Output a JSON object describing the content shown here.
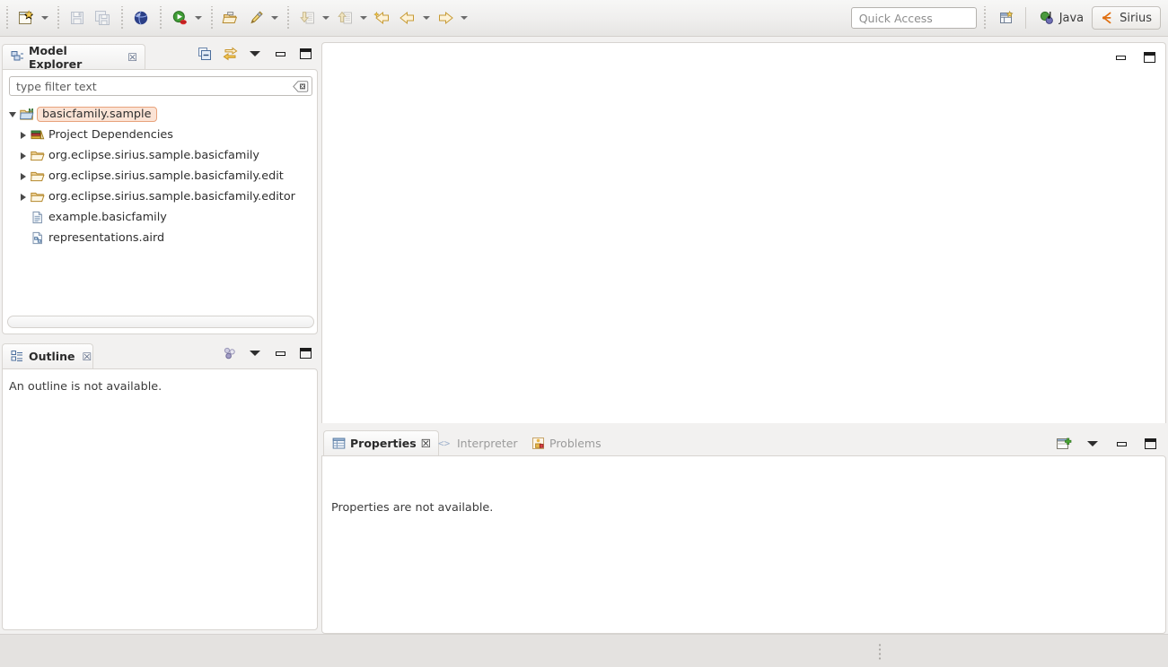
{
  "window": {
    "title": "Eclipse Sirius Workbench",
    "perspective": "Sirius"
  },
  "toolbar": {
    "items": [
      {
        "name": "new-wizard",
        "icon": "new-file-icon",
        "label": "New",
        "has_dropdown": true,
        "enabled": true
      },
      {
        "name": "save",
        "icon": "save-icon",
        "label": "Save",
        "has_dropdown": false,
        "enabled": false
      },
      {
        "name": "save-all",
        "icon": "save-all-icon",
        "label": "Save All",
        "has_dropdown": false,
        "enabled": false
      },
      {
        "name": "open-browser",
        "icon": "globe-icon",
        "label": "Open Web Browser",
        "has_dropdown": false,
        "enabled": true
      },
      {
        "name": "run",
        "icon": "run-icon",
        "label": "Run",
        "has_dropdown": true,
        "enabled": true
      },
      {
        "name": "new-folder",
        "icon": "open-folder-icon",
        "label": "New Folder",
        "has_dropdown": false,
        "enabled": true
      },
      {
        "name": "new-representation",
        "icon": "pencil-icon",
        "label": "New Representation",
        "has_dropdown": true,
        "enabled": true
      },
      {
        "name": "import",
        "icon": "import-icon",
        "label": "Import",
        "has_dropdown": true,
        "enabled": false
      },
      {
        "name": "export",
        "icon": "export-icon",
        "label": "Export",
        "has_dropdown": true,
        "enabled": false
      },
      {
        "name": "back-to-start",
        "icon": "back-star-arrow-icon",
        "label": "Back",
        "has_dropdown": false,
        "enabled": true
      },
      {
        "name": "previous-edit",
        "icon": "left-arrow-icon",
        "label": "Previous Annotation",
        "has_dropdown": true,
        "enabled": true
      },
      {
        "name": "next-edit",
        "icon": "right-arrow-icon",
        "label": "Next Annotation",
        "has_dropdown": true,
        "enabled": true
      }
    ],
    "quick_access": {
      "placeholder": "Quick Access",
      "value": ""
    },
    "open_perspective": {
      "icon": "open-perspective-icon",
      "label": "Open Perspective"
    },
    "perspectives": [
      {
        "name": "java",
        "label": "Java",
        "icon": "java-perspective-icon",
        "active": false
      },
      {
        "name": "sirius",
        "label": "Sirius",
        "icon": "sirius-perspective-icon",
        "active": true
      }
    ]
  },
  "model_explorer": {
    "tab_label": "Model Explorer",
    "tab_icon": "model-explorer-icon",
    "close_glyph": "☒",
    "tools": [
      {
        "name": "collapse-all",
        "icon": "collapse-all-icon",
        "tooltip": "Collapse All"
      },
      {
        "name": "link-with-editor",
        "icon": "link-with-editor-icon",
        "tooltip": "Link with Editor"
      },
      {
        "name": "view-menu",
        "icon": "view-menu-icon",
        "tooltip": "View Menu"
      },
      {
        "name": "minimize",
        "icon": "minimize-icon",
        "tooltip": "Minimize"
      },
      {
        "name": "maximize",
        "icon": "maximize-icon",
        "tooltip": "Maximize"
      }
    ],
    "filter": {
      "placeholder": "type filter text",
      "value": "",
      "clear_icon": "clear-field-icon"
    },
    "tree": [
      {
        "label": "basicfamily.sample",
        "icon": "modeling-project-icon",
        "twisty": "open",
        "indent": 0,
        "selected": true
      },
      {
        "label": "Project Dependencies",
        "icon": "libraries-icon",
        "twisty": "closed",
        "indent": 1,
        "selected": false
      },
      {
        "label": "org.eclipse.sirius.sample.basicfamily",
        "icon": "folder-icon",
        "twisty": "closed",
        "indent": 1,
        "selected": false
      },
      {
        "label": "org.eclipse.sirius.sample.basicfamily.edit",
        "icon": "folder-icon",
        "twisty": "closed",
        "indent": 1,
        "selected": false
      },
      {
        "label": "org.eclipse.sirius.sample.basicfamily.editor",
        "icon": "folder-icon",
        "twisty": "closed",
        "indent": 1,
        "selected": false
      },
      {
        "label": "example.basicfamily",
        "icon": "model-file-icon",
        "twisty": "none",
        "indent": 1,
        "selected": false
      },
      {
        "label": "representations.aird",
        "icon": "aird-file-icon",
        "twisty": "none",
        "indent": 1,
        "selected": false
      }
    ]
  },
  "outline": {
    "tab_label": "Outline",
    "tab_icon": "outline-icon",
    "close_glyph": "☒",
    "message": "An outline is not available.",
    "tools": [
      {
        "name": "outline-filters",
        "icon": "outline-dots-icon",
        "tooltip": "Filters"
      },
      {
        "name": "view-menu",
        "icon": "view-menu-icon",
        "tooltip": "View Menu"
      },
      {
        "name": "minimize",
        "icon": "minimize-icon",
        "tooltip": "Minimize"
      },
      {
        "name": "maximize",
        "icon": "maximize-icon",
        "tooltip": "Maximize"
      }
    ]
  },
  "editor_area": {
    "content": "",
    "tools": [
      {
        "name": "minimize",
        "icon": "minimize-icon",
        "tooltip": "Minimize"
      },
      {
        "name": "maximize",
        "icon": "maximize-icon",
        "tooltip": "Maximize"
      }
    ]
  },
  "properties_panel": {
    "tabs": [
      {
        "name": "properties",
        "label": "Properties",
        "icon": "properties-icon",
        "active": true,
        "close_glyph": "☒"
      },
      {
        "name": "interpreter",
        "label": "Interpreter",
        "icon": "interpreter-icon",
        "active": false
      },
      {
        "name": "problems",
        "label": "Problems",
        "icon": "problems-icon",
        "active": false
      }
    ],
    "message": "Properties are not available.",
    "tools": [
      {
        "name": "new-properties-view",
        "icon": "new-view-icon",
        "tooltip": "New Properties View"
      },
      {
        "name": "view-menu",
        "icon": "view-menu-icon",
        "tooltip": "View Menu"
      },
      {
        "name": "minimize",
        "icon": "minimize-icon",
        "tooltip": "Minimize"
      },
      {
        "name": "maximize",
        "icon": "maximize-icon",
        "tooltip": "Maximize"
      }
    ]
  },
  "status_bar": {
    "text": "",
    "resize_grip": "status-grip-icon"
  },
  "colors": {
    "toolbar_bg": "#efeeed",
    "panel_bg": "#ffffff",
    "selection_bg": "#fbe3d5",
    "selection_border": "#e8a37c",
    "folder_orange": "#e8a33d",
    "accent_blue": "#3a6ea5",
    "text": "#3c3c3c",
    "muted_text": "#9b9b9b"
  }
}
